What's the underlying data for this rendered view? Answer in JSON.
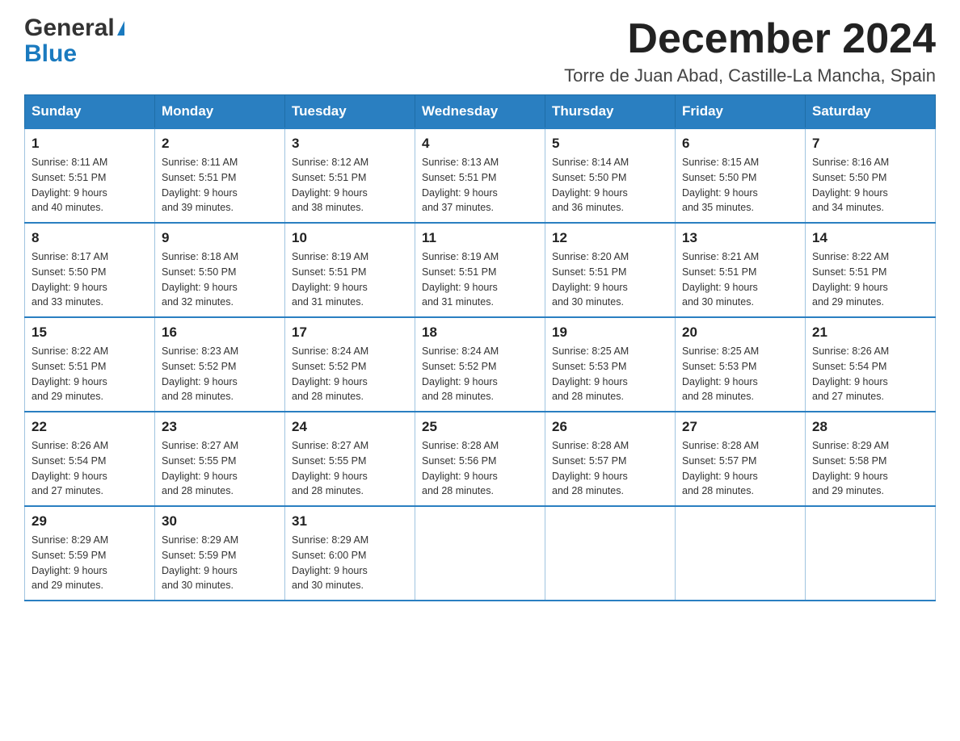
{
  "header": {
    "logo_general": "General",
    "logo_blue": "Blue",
    "month_title": "December 2024",
    "location": "Torre de Juan Abad, Castille-La Mancha, Spain"
  },
  "days_of_week": [
    "Sunday",
    "Monday",
    "Tuesday",
    "Wednesday",
    "Thursday",
    "Friday",
    "Saturday"
  ],
  "weeks": [
    [
      {
        "day": "1",
        "sunrise": "8:11 AM",
        "sunset": "5:51 PM",
        "daylight": "9 hours and 40 minutes."
      },
      {
        "day": "2",
        "sunrise": "8:11 AM",
        "sunset": "5:51 PM",
        "daylight": "9 hours and 39 minutes."
      },
      {
        "day": "3",
        "sunrise": "8:12 AM",
        "sunset": "5:51 PM",
        "daylight": "9 hours and 38 minutes."
      },
      {
        "day": "4",
        "sunrise": "8:13 AM",
        "sunset": "5:51 PM",
        "daylight": "9 hours and 37 minutes."
      },
      {
        "day": "5",
        "sunrise": "8:14 AM",
        "sunset": "5:50 PM",
        "daylight": "9 hours and 36 minutes."
      },
      {
        "day": "6",
        "sunrise": "8:15 AM",
        "sunset": "5:50 PM",
        "daylight": "9 hours and 35 minutes."
      },
      {
        "day": "7",
        "sunrise": "8:16 AM",
        "sunset": "5:50 PM",
        "daylight": "9 hours and 34 minutes."
      }
    ],
    [
      {
        "day": "8",
        "sunrise": "8:17 AM",
        "sunset": "5:50 PM",
        "daylight": "9 hours and 33 minutes."
      },
      {
        "day": "9",
        "sunrise": "8:18 AM",
        "sunset": "5:50 PM",
        "daylight": "9 hours and 32 minutes."
      },
      {
        "day": "10",
        "sunrise": "8:19 AM",
        "sunset": "5:51 PM",
        "daylight": "9 hours and 31 minutes."
      },
      {
        "day": "11",
        "sunrise": "8:19 AM",
        "sunset": "5:51 PM",
        "daylight": "9 hours and 31 minutes."
      },
      {
        "day": "12",
        "sunrise": "8:20 AM",
        "sunset": "5:51 PM",
        "daylight": "9 hours and 30 minutes."
      },
      {
        "day": "13",
        "sunrise": "8:21 AM",
        "sunset": "5:51 PM",
        "daylight": "9 hours and 30 minutes."
      },
      {
        "day": "14",
        "sunrise": "8:22 AM",
        "sunset": "5:51 PM",
        "daylight": "9 hours and 29 minutes."
      }
    ],
    [
      {
        "day": "15",
        "sunrise": "8:22 AM",
        "sunset": "5:51 PM",
        "daylight": "9 hours and 29 minutes."
      },
      {
        "day": "16",
        "sunrise": "8:23 AM",
        "sunset": "5:52 PM",
        "daylight": "9 hours and 28 minutes."
      },
      {
        "day": "17",
        "sunrise": "8:24 AM",
        "sunset": "5:52 PM",
        "daylight": "9 hours and 28 minutes."
      },
      {
        "day": "18",
        "sunrise": "8:24 AM",
        "sunset": "5:52 PM",
        "daylight": "9 hours and 28 minutes."
      },
      {
        "day": "19",
        "sunrise": "8:25 AM",
        "sunset": "5:53 PM",
        "daylight": "9 hours and 28 minutes."
      },
      {
        "day": "20",
        "sunrise": "8:25 AM",
        "sunset": "5:53 PM",
        "daylight": "9 hours and 28 minutes."
      },
      {
        "day": "21",
        "sunrise": "8:26 AM",
        "sunset": "5:54 PM",
        "daylight": "9 hours and 27 minutes."
      }
    ],
    [
      {
        "day": "22",
        "sunrise": "8:26 AM",
        "sunset": "5:54 PM",
        "daylight": "9 hours and 27 minutes."
      },
      {
        "day": "23",
        "sunrise": "8:27 AM",
        "sunset": "5:55 PM",
        "daylight": "9 hours and 28 minutes."
      },
      {
        "day": "24",
        "sunrise": "8:27 AM",
        "sunset": "5:55 PM",
        "daylight": "9 hours and 28 minutes."
      },
      {
        "day": "25",
        "sunrise": "8:28 AM",
        "sunset": "5:56 PM",
        "daylight": "9 hours and 28 minutes."
      },
      {
        "day": "26",
        "sunrise": "8:28 AM",
        "sunset": "5:57 PM",
        "daylight": "9 hours and 28 minutes."
      },
      {
        "day": "27",
        "sunrise": "8:28 AM",
        "sunset": "5:57 PM",
        "daylight": "9 hours and 28 minutes."
      },
      {
        "day": "28",
        "sunrise": "8:29 AM",
        "sunset": "5:58 PM",
        "daylight": "9 hours and 29 minutes."
      }
    ],
    [
      {
        "day": "29",
        "sunrise": "8:29 AM",
        "sunset": "5:59 PM",
        "daylight": "9 hours and 29 minutes."
      },
      {
        "day": "30",
        "sunrise": "8:29 AM",
        "sunset": "5:59 PM",
        "daylight": "9 hours and 30 minutes."
      },
      {
        "day": "31",
        "sunrise": "8:29 AM",
        "sunset": "6:00 PM",
        "daylight": "9 hours and 30 minutes."
      },
      null,
      null,
      null,
      null
    ]
  ],
  "labels": {
    "sunrise": "Sunrise:",
    "sunset": "Sunset:",
    "daylight": "Daylight:"
  }
}
